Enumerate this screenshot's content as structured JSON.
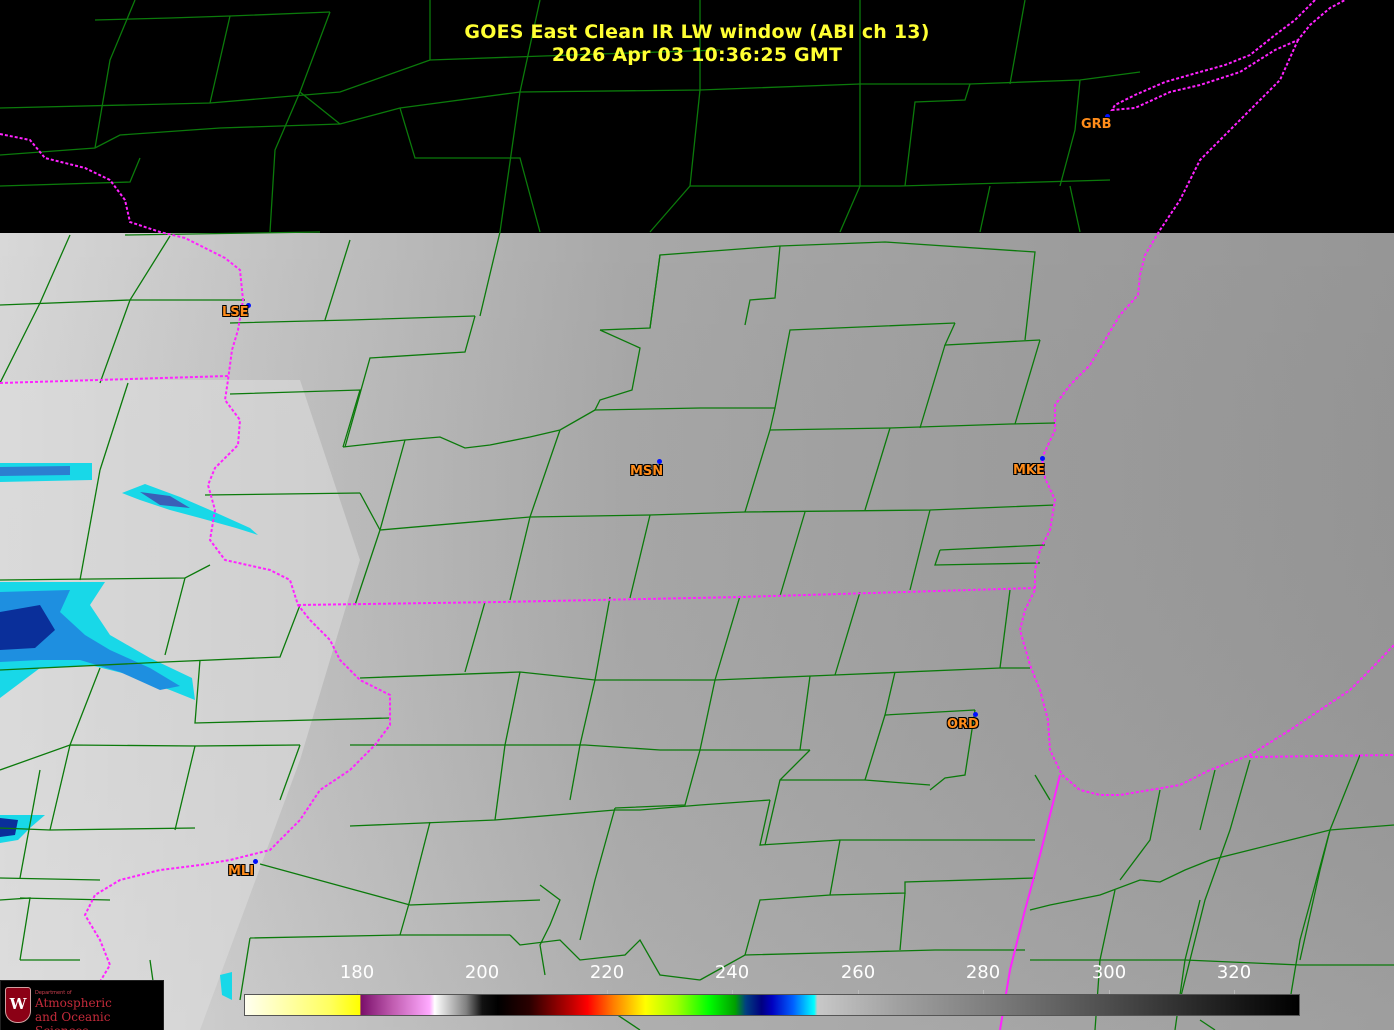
{
  "title": {
    "line1": "GOES East Clean IR LW window (ABI ch 13)",
    "line2": "2026 Apr 03  10:36:25 GMT"
  },
  "stations": [
    {
      "id": "GRB",
      "label": "GRB"
    },
    {
      "id": "LSE",
      "label": "LSE"
    },
    {
      "id": "MSN",
      "label": "MSN"
    },
    {
      "id": "MKE",
      "label": "MKE"
    },
    {
      "id": "ORD",
      "label": "ORD"
    },
    {
      "id": "MLI",
      "label": "MLI"
    }
  ],
  "colorbar": {
    "ticks": [
      "180",
      "200",
      "220",
      "240",
      "260",
      "280",
      "300",
      "320"
    ]
  },
  "logo": {
    "dept": "Department of",
    "line1": "Atmospheric",
    "line2": "and Oceanic Sciences"
  },
  "colors": {
    "title": "#ffff33",
    "county_lines": "#0b7a0b",
    "state_lines": "#ff22ff",
    "station_label": "#ff8c1a",
    "station_dot": "#0010ff",
    "no_data": "#000000"
  }
}
